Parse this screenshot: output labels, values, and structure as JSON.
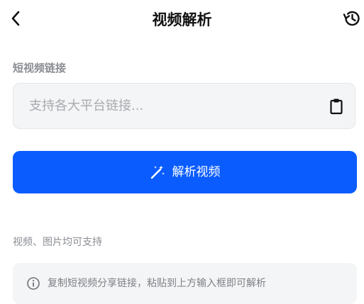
{
  "header": {
    "title": "视频解析",
    "back_icon": "chevron-left-icon",
    "history_icon": "history-icon"
  },
  "form": {
    "section_label": "短视频链接",
    "input_placeholder": "支持各大平台链接...",
    "input_value": "",
    "paste_icon": "clipboard-icon"
  },
  "parse_button": {
    "label": "解析视频",
    "icon": "magic-wand-icon"
  },
  "support_text": "视频、图片均可支持",
  "tip": {
    "icon": "info-icon",
    "text": "复制短视频分享链接，粘贴到上方输入框即可解析"
  },
  "colors": {
    "primary": "#0a5cff",
    "input_bg": "#f4f5f6",
    "muted_text": "#8a8d93"
  }
}
